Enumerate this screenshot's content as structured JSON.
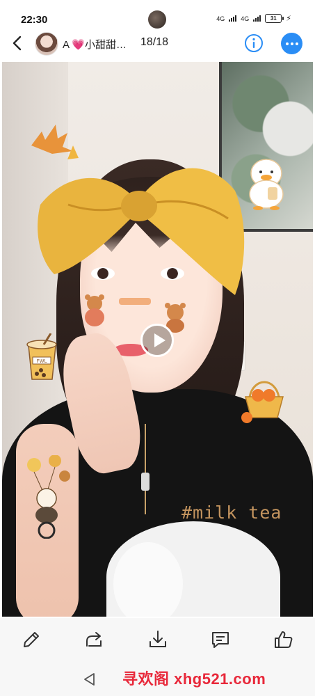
{
  "status_bar": {
    "time": "22:30",
    "network1": "4G",
    "network2": "4G",
    "battery": "31"
  },
  "header": {
    "title": "A 💗小甜甜…",
    "counter": "18/18"
  },
  "media": {
    "hashtag": "#milk tea",
    "sticker_text": "FWL"
  },
  "watermark": "寻欢阁 xhg521.com",
  "colors": {
    "accent": "#2a8df5",
    "watermark": "#e8283a",
    "hashtag": "#c5955f"
  },
  "icons": {
    "back": "chevron-left-icon",
    "info": "info-icon",
    "more": "more-icon",
    "play": "play-icon",
    "edit": "pencil-icon",
    "share": "share-icon",
    "download": "download-icon",
    "comment": "comment-icon",
    "like": "thumbs-up-icon",
    "nav_back": "triangle-back-icon"
  }
}
